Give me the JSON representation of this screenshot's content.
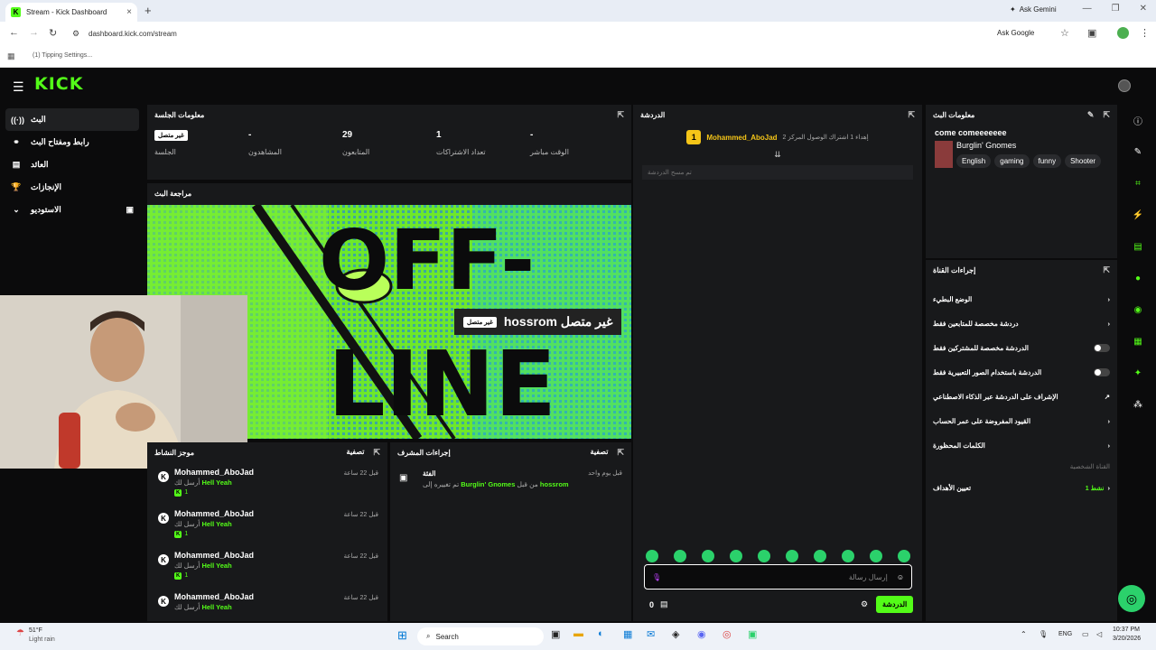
{
  "browser": {
    "tab_title": "Stream - Kick Dashboard",
    "url": "dashboard.kick.com/stream",
    "ask_gemini": "Ask Gemini",
    "ask_google": "Ask Google",
    "bookmark": "(1) Tipping Settings..."
  },
  "app": {
    "logo": "KICK"
  },
  "sidebar": {
    "items": [
      {
        "label": "البث",
        "icon": "stream-icon"
      },
      {
        "label": "رابط ومفتاح البث",
        "icon": "link-icon"
      },
      {
        "label": "العائد",
        "icon": "revenue-icon"
      },
      {
        "label": "الإنجازات",
        "icon": "trophy-icon"
      },
      {
        "label": "الاستوديو",
        "icon": "chevron-down-icon"
      }
    ]
  },
  "session": {
    "title": "معلومات الجلسة",
    "stats": [
      {
        "value": "غير متصل",
        "label": "الجلسة"
      },
      {
        "value": "-",
        "label": "المشاهدون"
      },
      {
        "value": "29",
        "label": "المتابعون"
      },
      {
        "value": "1",
        "label": "تعداد الاشتراكات"
      },
      {
        "value": "-",
        "label": "الوقت مباشر"
      }
    ]
  },
  "preview": {
    "title": "مراجعة البث",
    "offline_badge": "غير متصل",
    "streamer": "hossrom غير متصل",
    "word1": "OFF-",
    "word2": "LINE"
  },
  "activity": {
    "title": "موجز النشاط",
    "filter": "تصفية",
    "items": [
      {
        "user": "Mohammed_AboJad",
        "time": "قبل 22 ساعة",
        "msg": "Hell Yeah",
        "action": "أرسل لك",
        "count": "1"
      },
      {
        "user": "Mohammed_AboJad",
        "time": "قبل 22 ساعة",
        "msg": "Hell Yeah",
        "action": "أرسل لك",
        "count": "1"
      },
      {
        "user": "Mohammed_AboJad",
        "time": "قبل 22 ساعة",
        "msg": "Hell Yeah",
        "action": "أرسل لك",
        "count": "1"
      },
      {
        "user": "Mohammed_AboJad",
        "time": "قبل 22 ساعة",
        "msg": "Hell Yeah",
        "action": "أرسل لك"
      }
    ]
  },
  "mod": {
    "title": "إجراءات المشرف",
    "filter": "تصفية",
    "item_title": "الفئة",
    "item_time": "قبل يوم واحد",
    "item_desc_pre": "تم تغييره إلى",
    "item_game": "Burglin' Gnomes",
    "item_mid": "من قبل",
    "item_user": "hossrom"
  },
  "chat": {
    "title": "الدردشة",
    "pinned_user": "Mohammed_AboJad",
    "pinned_rank": "1",
    "pinned_note": "إهداء 1 اشتراك الوصول المركز 2",
    "cleared": "تم مسح الدردشة",
    "placeholder": "إرسال رسالة",
    "count": "0",
    "send": "الدردشة"
  },
  "streaminfo": {
    "title_label": "معلومات البث",
    "title": "come comeeeeeee",
    "game": "Burglin' Gnomes",
    "tags": [
      "English",
      "gaming",
      "funny",
      "Shooter"
    ]
  },
  "channel": {
    "title": "إجراءات القناة",
    "actions": [
      {
        "label": "الوضع البطيء",
        "type": "arrow"
      },
      {
        "label": "دردشة مخصصة للمتابعين فقط",
        "type": "arrow"
      },
      {
        "label": "الدردشة مخصصة للمشتركين فقط",
        "type": "toggle"
      },
      {
        "label": "الدردشة باستخدام الصور التعبيرية فقط",
        "type": "toggle"
      },
      {
        "label": "الإشراف على الدردشة عبر الذكاء الاصطناعي",
        "type": "link"
      },
      {
        "label": "القيود المفروضة على عمر الحساب",
        "type": "arrow"
      },
      {
        "label": "الكلمات المحظورة",
        "type": "arrow"
      }
    ],
    "section": "القناة الشخصية",
    "goals": "تعيين الأهداف",
    "goals_status": "نشط 1"
  },
  "taskbar": {
    "temp": "51°F",
    "weather": "Light rain",
    "search": "Search",
    "lang": "ENG",
    "time": "10:37 PM",
    "date": "3/20/2026"
  },
  "colors": {
    "accent": "#53fc18",
    "panel": "#18191b",
    "bg": "#0b0b0c"
  }
}
